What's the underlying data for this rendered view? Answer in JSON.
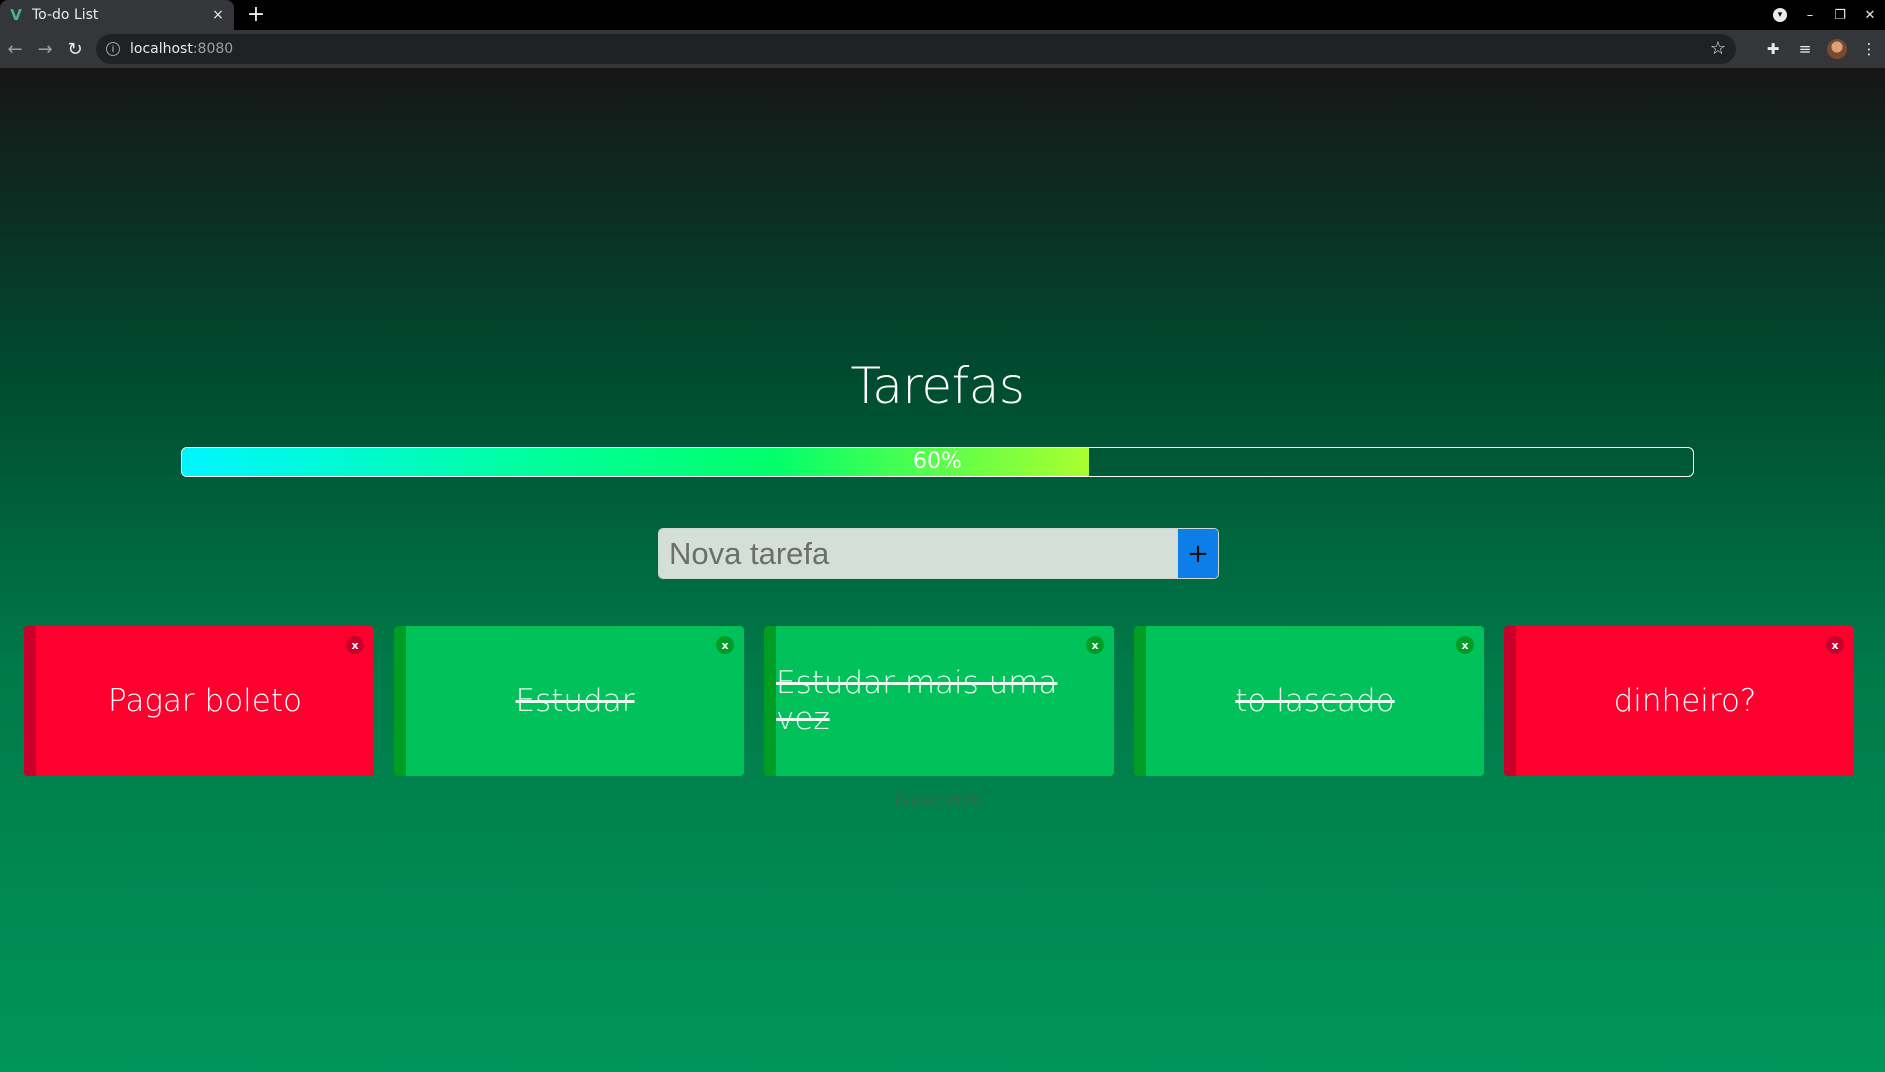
{
  "browser": {
    "tab": {
      "title": "To-do List",
      "favicon": "V",
      "close": "×"
    },
    "new_tab": "+",
    "omnibox": {
      "host": "localhost",
      "port": ":8080"
    },
    "icons": [
      "back-icon",
      "forward-icon",
      "reload-icon",
      "info-icon",
      "star-icon",
      "extensions-icon",
      "media-icon",
      "avatar",
      "menu-icon"
    ]
  },
  "page": {
    "title": "Tarefas",
    "progress": {
      "percent": 60,
      "label": "60%"
    },
    "new_task": {
      "placeholder": "Nova tarefa",
      "add_label": "+"
    },
    "tasks": [
      {
        "label": "Pagar boleto",
        "done": false
      },
      {
        "label": "Estudar",
        "done": true
      },
      {
        "label": "Estudar mais uma vez",
        "done": true
      },
      {
        "label": "to lascado",
        "done": true
      },
      {
        "label": "dinheiro?",
        "done": false
      }
    ],
    "task_close": "x",
    "footer": "isaacwrk"
  },
  "colors": {
    "pending": "#fe002e",
    "done": "#00c15a",
    "add_button": "#0d7ee8"
  }
}
